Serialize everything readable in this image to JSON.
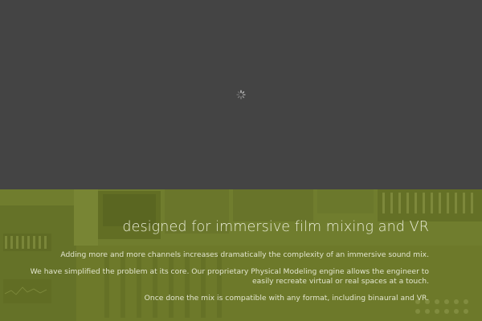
{
  "loader": {
    "icon": "loading-spinner-icon"
  },
  "hero": {
    "headline": "designed for immersive film mixing and VR",
    "paragraph1": "Adding more and more channels increases dramatically the complexity of an immersive sound mix.",
    "paragraph2_line1": "We have simplified the problem at its core.  Our proprietary Physical Modeling engine allows the engineer to",
    "paragraph2_line2": "easily recreate virtual or real spaces at a touch.",
    "paragraph3": "Once done the mix is compatible with any format, including binaural and VR.",
    "background": "mixing-console-photo",
    "overlay_color": "#6e7a2e"
  },
  "colors": {
    "page_background": "#444444",
    "text": "#e9ecd6"
  }
}
